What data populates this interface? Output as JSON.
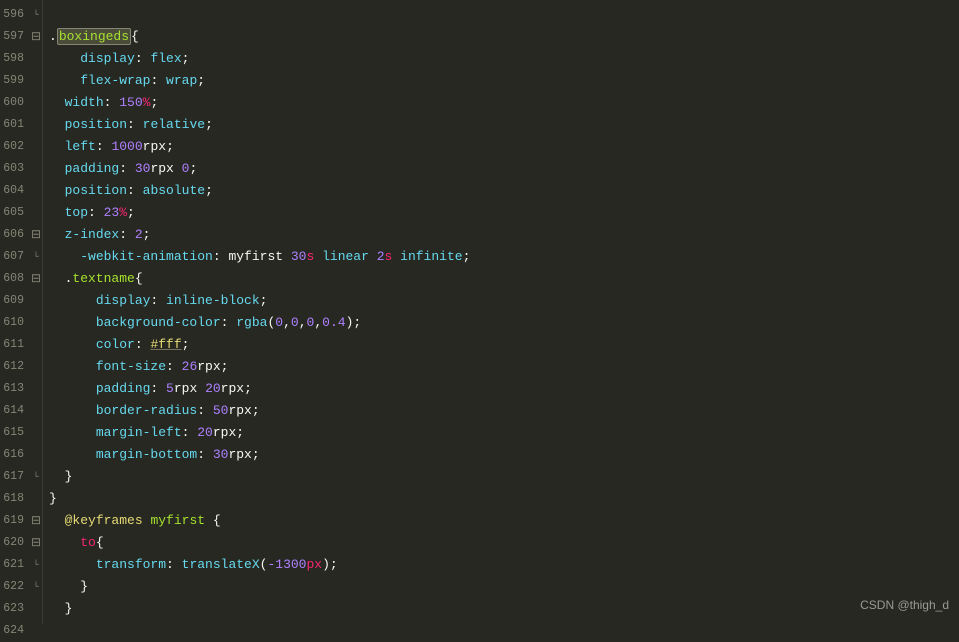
{
  "watermark": "CSDN @thigh_d",
  "lines": [
    {
      "num": "596",
      "fold": "corner",
      "tokens": []
    },
    {
      "num": "597",
      "fold": "minus",
      "tokens": [
        {
          "t": ".",
          "c": "tk-punc"
        },
        {
          "t": "boxingeds",
          "c": "tk-sel hl-box"
        },
        {
          "t": "{",
          "c": "tk-punc"
        }
      ]
    },
    {
      "num": "598",
      "fold": "",
      "tokens": [
        {
          "t": "    ",
          "c": ""
        },
        {
          "t": "display",
          "c": "tk-prop"
        },
        {
          "t": ": ",
          "c": "tk-punc"
        },
        {
          "t": "flex",
          "c": "tk-val"
        },
        {
          "t": ";",
          "c": "tk-punc"
        }
      ]
    },
    {
      "num": "599",
      "fold": "",
      "tokens": [
        {
          "t": "    ",
          "c": ""
        },
        {
          "t": "flex-wrap",
          "c": "tk-prop"
        },
        {
          "t": ": ",
          "c": "tk-punc"
        },
        {
          "t": "wrap",
          "c": "tk-val"
        },
        {
          "t": ";",
          "c": "tk-punc"
        }
      ]
    },
    {
      "num": "600",
      "fold": "",
      "tokens": [
        {
          "t": "  ",
          "c": ""
        },
        {
          "t": "width",
          "c": "tk-prop"
        },
        {
          "t": ": ",
          "c": "tk-punc"
        },
        {
          "t": "150",
          "c": "tk-num"
        },
        {
          "t": "%",
          "c": "tk-unit"
        },
        {
          "t": ";",
          "c": "tk-punc"
        }
      ]
    },
    {
      "num": "601",
      "fold": "",
      "tokens": [
        {
          "t": "  ",
          "c": ""
        },
        {
          "t": "position",
          "c": "tk-prop"
        },
        {
          "t": ": ",
          "c": "tk-punc"
        },
        {
          "t": "relative",
          "c": "tk-val"
        },
        {
          "t": ";",
          "c": "tk-punc"
        }
      ]
    },
    {
      "num": "602",
      "fold": "",
      "tokens": [
        {
          "t": "  ",
          "c": ""
        },
        {
          "t": "left",
          "c": "tk-prop"
        },
        {
          "t": ": ",
          "c": "tk-punc"
        },
        {
          "t": "1000",
          "c": "tk-num"
        },
        {
          "t": "rpx",
          "c": "tk-ident"
        },
        {
          "t": ";",
          "c": "tk-punc"
        }
      ]
    },
    {
      "num": "603",
      "fold": "",
      "tokens": [
        {
          "t": "  ",
          "c": ""
        },
        {
          "t": "padding",
          "c": "tk-prop"
        },
        {
          "t": ": ",
          "c": "tk-punc"
        },
        {
          "t": "30",
          "c": "tk-num"
        },
        {
          "t": "rpx ",
          "c": "tk-ident"
        },
        {
          "t": "0",
          "c": "tk-num"
        },
        {
          "t": ";",
          "c": "tk-punc"
        }
      ]
    },
    {
      "num": "604",
      "fold": "",
      "tokens": [
        {
          "t": "  ",
          "c": ""
        },
        {
          "t": "position",
          "c": "tk-prop"
        },
        {
          "t": ": ",
          "c": "tk-punc"
        },
        {
          "t": "absolute",
          "c": "tk-val"
        },
        {
          "t": ";",
          "c": "tk-punc"
        }
      ]
    },
    {
      "num": "605",
      "fold": "",
      "tokens": [
        {
          "t": "  ",
          "c": ""
        },
        {
          "t": "top",
          "c": "tk-prop"
        },
        {
          "t": ": ",
          "c": "tk-punc"
        },
        {
          "t": "23",
          "c": "tk-num"
        },
        {
          "t": "%",
          "c": "tk-unit"
        },
        {
          "t": ";",
          "c": "tk-punc"
        }
      ]
    },
    {
      "num": "606",
      "fold": "minus",
      "tokens": [
        {
          "t": "  ",
          "c": ""
        },
        {
          "t": "z-index",
          "c": "tk-prop"
        },
        {
          "t": ": ",
          "c": "tk-punc"
        },
        {
          "t": "2",
          "c": "tk-num"
        },
        {
          "t": ";",
          "c": "tk-punc"
        }
      ]
    },
    {
      "num": "607",
      "fold": "corner",
      "tokens": [
        {
          "t": "    ",
          "c": ""
        },
        {
          "t": "-webkit-animation",
          "c": "tk-prop"
        },
        {
          "t": ": myfirst ",
          "c": "tk-punc"
        },
        {
          "t": "30",
          "c": "tk-num"
        },
        {
          "t": "s",
          "c": "tk-unit"
        },
        {
          "t": " ",
          "c": ""
        },
        {
          "t": "linear",
          "c": "tk-val"
        },
        {
          "t": " ",
          "c": ""
        },
        {
          "t": "2",
          "c": "tk-num"
        },
        {
          "t": "s",
          "c": "tk-unit"
        },
        {
          "t": " ",
          "c": ""
        },
        {
          "t": "infinite",
          "c": "tk-val"
        },
        {
          "t": ";",
          "c": "tk-punc"
        }
      ]
    },
    {
      "num": "608",
      "fold": "minus",
      "tokens": [
        {
          "t": "  .",
          "c": "tk-punc"
        },
        {
          "t": "textname",
          "c": "tk-sel"
        },
        {
          "t": "{",
          "c": "tk-punc"
        }
      ]
    },
    {
      "num": "609",
      "fold": "",
      "tokens": [
        {
          "t": "      ",
          "c": ""
        },
        {
          "t": "display",
          "c": "tk-prop"
        },
        {
          "t": ": ",
          "c": "tk-punc"
        },
        {
          "t": "inline-block",
          "c": "tk-val"
        },
        {
          "t": ";",
          "c": "tk-punc"
        }
      ]
    },
    {
      "num": "610",
      "fold": "",
      "tokens": [
        {
          "t": "      ",
          "c": ""
        },
        {
          "t": "background-color",
          "c": "tk-prop"
        },
        {
          "t": ": ",
          "c": "tk-punc"
        },
        {
          "t": "rgba",
          "c": "tk-name"
        },
        {
          "t": "(",
          "c": "tk-punc"
        },
        {
          "t": "0",
          "c": "tk-num"
        },
        {
          "t": ",",
          "c": "tk-punc"
        },
        {
          "t": "0",
          "c": "tk-num"
        },
        {
          "t": ",",
          "c": "tk-punc"
        },
        {
          "t": "0",
          "c": "tk-num"
        },
        {
          "t": ",",
          "c": "tk-punc"
        },
        {
          "t": "0.4",
          "c": "tk-num"
        },
        {
          "t": ");",
          "c": "tk-punc"
        }
      ]
    },
    {
      "num": "611",
      "fold": "",
      "tokens": [
        {
          "t": "      ",
          "c": ""
        },
        {
          "t": "color",
          "c": "tk-prop"
        },
        {
          "t": ": ",
          "c": "tk-punc"
        },
        {
          "t": "#fff",
          "c": "tk-hex"
        },
        {
          "t": ";",
          "c": "tk-punc"
        }
      ]
    },
    {
      "num": "612",
      "fold": "",
      "tokens": [
        {
          "t": "      ",
          "c": ""
        },
        {
          "t": "font-size",
          "c": "tk-prop"
        },
        {
          "t": ": ",
          "c": "tk-punc"
        },
        {
          "t": "26",
          "c": "tk-num"
        },
        {
          "t": "rpx",
          "c": "tk-ident"
        },
        {
          "t": ";",
          "c": "tk-punc"
        }
      ]
    },
    {
      "num": "613",
      "fold": "",
      "tokens": [
        {
          "t": "      ",
          "c": ""
        },
        {
          "t": "padding",
          "c": "tk-prop"
        },
        {
          "t": ": ",
          "c": "tk-punc"
        },
        {
          "t": "5",
          "c": "tk-num"
        },
        {
          "t": "rpx ",
          "c": "tk-ident"
        },
        {
          "t": "20",
          "c": "tk-num"
        },
        {
          "t": "rpx",
          "c": "tk-ident"
        },
        {
          "t": ";",
          "c": "tk-punc"
        }
      ]
    },
    {
      "num": "614",
      "fold": "",
      "tokens": [
        {
          "t": "      ",
          "c": ""
        },
        {
          "t": "border-radius",
          "c": "tk-prop"
        },
        {
          "t": ": ",
          "c": "tk-punc"
        },
        {
          "t": "50",
          "c": "tk-num"
        },
        {
          "t": "rpx",
          "c": "tk-ident"
        },
        {
          "t": ";",
          "c": "tk-punc"
        }
      ]
    },
    {
      "num": "615",
      "fold": "",
      "tokens": [
        {
          "t": "      ",
          "c": ""
        },
        {
          "t": "margin-left",
          "c": "tk-prop"
        },
        {
          "t": ": ",
          "c": "tk-punc"
        },
        {
          "t": "20",
          "c": "tk-num"
        },
        {
          "t": "rpx",
          "c": "tk-ident"
        },
        {
          "t": ";",
          "c": "tk-punc"
        }
      ]
    },
    {
      "num": "616",
      "fold": "",
      "tokens": [
        {
          "t": "      ",
          "c": ""
        },
        {
          "t": "margin-bottom",
          "c": "tk-prop"
        },
        {
          "t": ": ",
          "c": "tk-punc"
        },
        {
          "t": "30",
          "c": "tk-num"
        },
        {
          "t": "rpx",
          "c": "tk-ident"
        },
        {
          "t": ";",
          "c": "tk-punc"
        }
      ]
    },
    {
      "num": "617",
      "fold": "corner",
      "tokens": [
        {
          "t": "  }",
          "c": "tk-punc"
        }
      ]
    },
    {
      "num": "618",
      "fold": "",
      "tokens": [
        {
          "t": "}",
          "c": "tk-punc"
        }
      ]
    },
    {
      "num": "619",
      "fold": "minus",
      "tokens": [
        {
          "t": "  ",
          "c": ""
        },
        {
          "t": "@keyframes",
          "c": "tk-at"
        },
        {
          "t": " ",
          "c": ""
        },
        {
          "t": "myfirst",
          "c": "tk-sel"
        },
        {
          "t": " {",
          "c": "tk-punc"
        }
      ]
    },
    {
      "num": "620",
      "fold": "minus",
      "tokens": [
        {
          "t": "    ",
          "c": ""
        },
        {
          "t": "to",
          "c": "tk-kw"
        },
        {
          "t": "{",
          "c": "tk-punc"
        }
      ]
    },
    {
      "num": "621",
      "fold": "corner",
      "tokens": [
        {
          "t": "      ",
          "c": ""
        },
        {
          "t": "transform",
          "c": "tk-prop"
        },
        {
          "t": ": ",
          "c": "tk-punc"
        },
        {
          "t": "translateX",
          "c": "tk-name"
        },
        {
          "t": "(",
          "c": "tk-punc"
        },
        {
          "t": "-1300",
          "c": "tk-num"
        },
        {
          "t": "px",
          "c": "tk-unit"
        },
        {
          "t": ");",
          "c": "tk-punc"
        }
      ]
    },
    {
      "num": "622",
      "fold": "corner",
      "tokens": [
        {
          "t": "    }",
          "c": "tk-punc"
        }
      ]
    },
    {
      "num": "623",
      "fold": "",
      "tokens": [
        {
          "t": "  }",
          "c": "tk-punc"
        }
      ]
    },
    {
      "num": "624",
      "fold": "",
      "tokens": []
    }
  ]
}
